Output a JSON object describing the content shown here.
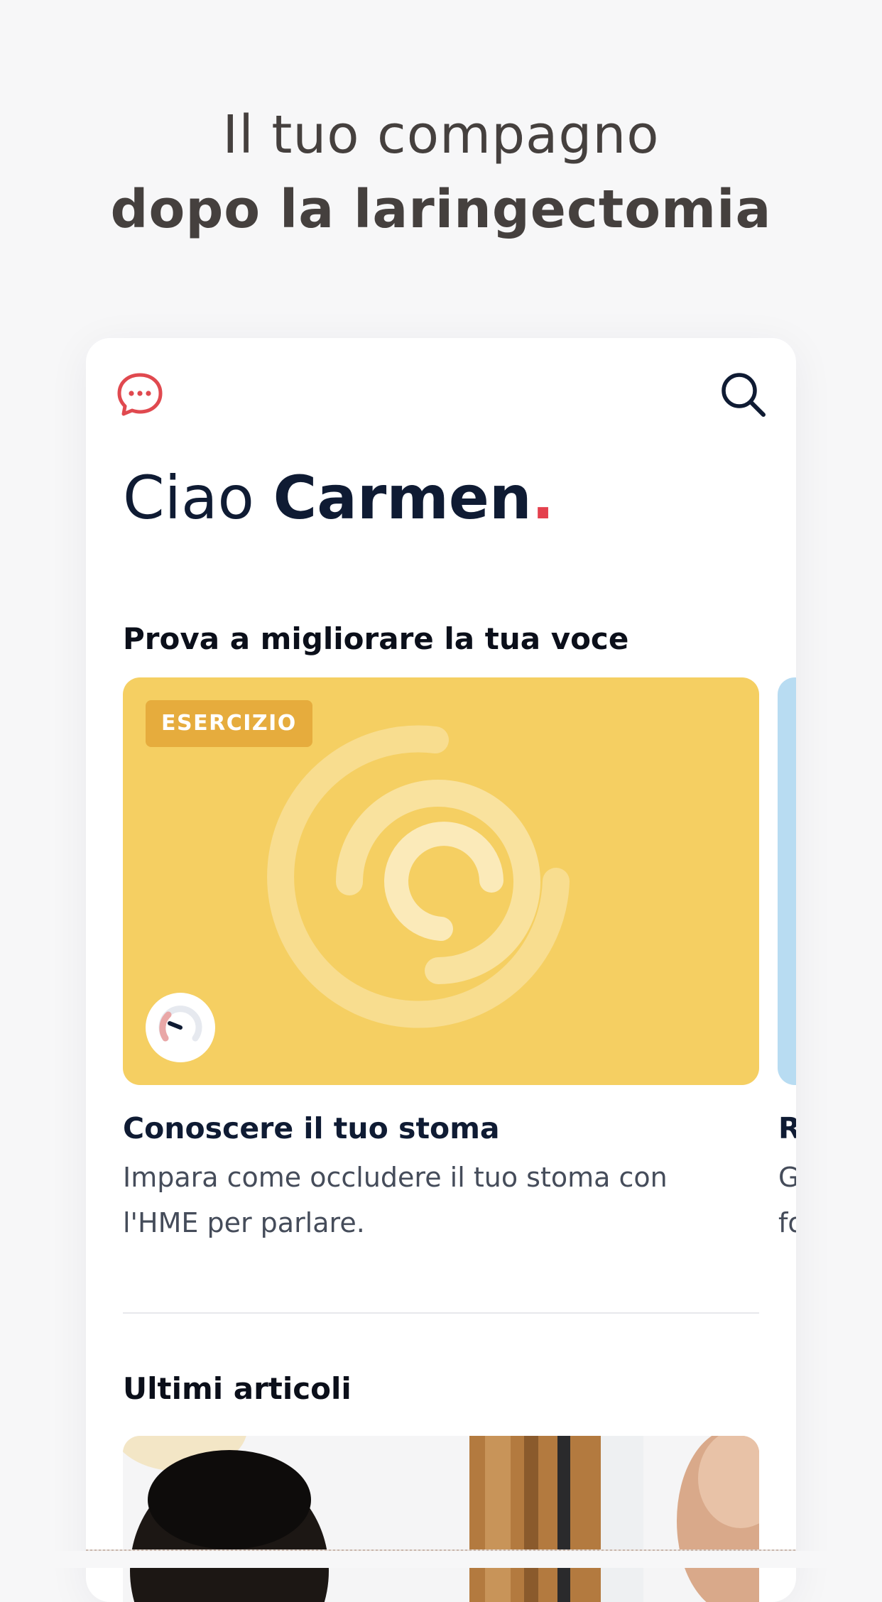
{
  "hero": {
    "line1": "Il tuo compagno",
    "line2": "dopo la laringectomia"
  },
  "header": {
    "chat_icon": "chat-bubble-icon",
    "search_icon": "search-icon"
  },
  "greeting": {
    "hello": "Ciao",
    "name": "Carmen",
    "dot": "."
  },
  "voice_section": {
    "title": "Prova a migliorare la tua voce",
    "cards": [
      {
        "badge": "ESERCIZIO",
        "title": "Conoscere il tuo stoma",
        "description": "Impara come occludere il tuo stoma con l'HME per parlare.",
        "color": "#f5cf62",
        "badge_color": "#e6ac3d",
        "art_icon": "concentric-rings-icon",
        "difficulty_icon": "gauge-icon"
      },
      {
        "title": "R",
        "description": "G\nfo",
        "color": "#b8dcf2"
      }
    ]
  },
  "articles_section": {
    "title": "Ultimi articoli"
  },
  "colors": {
    "accent": "#e4404d",
    "text_dark": "#0f1b33",
    "hero_text": "#45403e"
  }
}
